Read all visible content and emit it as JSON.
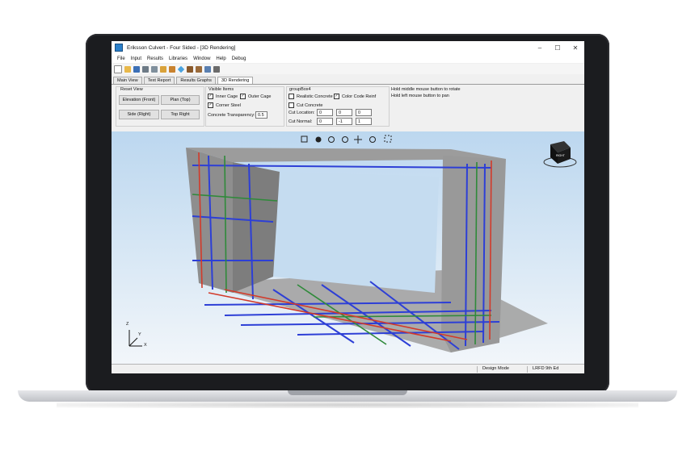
{
  "window": {
    "title": "Eriksson Culvert - Four Sided - [3D Rendering]",
    "controls": [
      "–",
      "☐",
      "✕"
    ]
  },
  "menu": [
    "File",
    "Input",
    "Results",
    "Libraries",
    "Window",
    "Help",
    "Debug"
  ],
  "toolbar_icons": [
    "new-file-icon",
    "open-folder-icon",
    "save-icon",
    "print-icon",
    "print-preview-icon",
    "export-icon",
    "settings-icon",
    "diamond-icon",
    "library-icon",
    "tools-icon",
    "report-icon",
    "grid-icon"
  ],
  "tabs": [
    {
      "label": "Main View",
      "active": false
    },
    {
      "label": "Text Report",
      "active": false
    },
    {
      "label": "Results Graphs",
      "active": false
    },
    {
      "label": "3D Rendering",
      "active": true
    }
  ],
  "reset_view": {
    "title": "Reset View",
    "elevation": "Elevation (Front)",
    "plan": "Plan (Top)",
    "side": "Side (Right)",
    "top_right": "Top Right"
  },
  "visible_items": {
    "title": "Visible Items",
    "inner_cage": "Inner Cage",
    "outer_cage": "Outer Cage",
    "corner_steel": "Corner Steel",
    "transparency_label": "Concrete Transparency:",
    "transparency_value": "0.5"
  },
  "groupbox": {
    "title": "groupBox4",
    "realistic": "Realistic Concrete",
    "color_code": "Color Code Reinf",
    "cut": "Cut Concrete",
    "cut_location_label": "Cut Location:",
    "cut_location": [
      "0",
      "0",
      "0"
    ],
    "cut_normal_label": "Cut Normal:",
    "cut_normal": [
      "0",
      "-1",
      "1"
    ]
  },
  "hints": {
    "rotate": "Hold middle mouse button to rotate",
    "pan": "Hold left mouse button to pan"
  },
  "viewcube_label": "RIGHT",
  "axis_labels": {
    "z": "Z",
    "y": "Y",
    "x": "X"
  },
  "status": {
    "mode": "Design Mode",
    "code": "LRFD 9th Ed"
  },
  "colors": {
    "accent": "#2a7fc9",
    "rebar_blue": "#2d3fd6",
    "rebar_green": "#2f8a3a",
    "rebar_red": "#d23a2a",
    "concrete": "#9a9a9a"
  }
}
